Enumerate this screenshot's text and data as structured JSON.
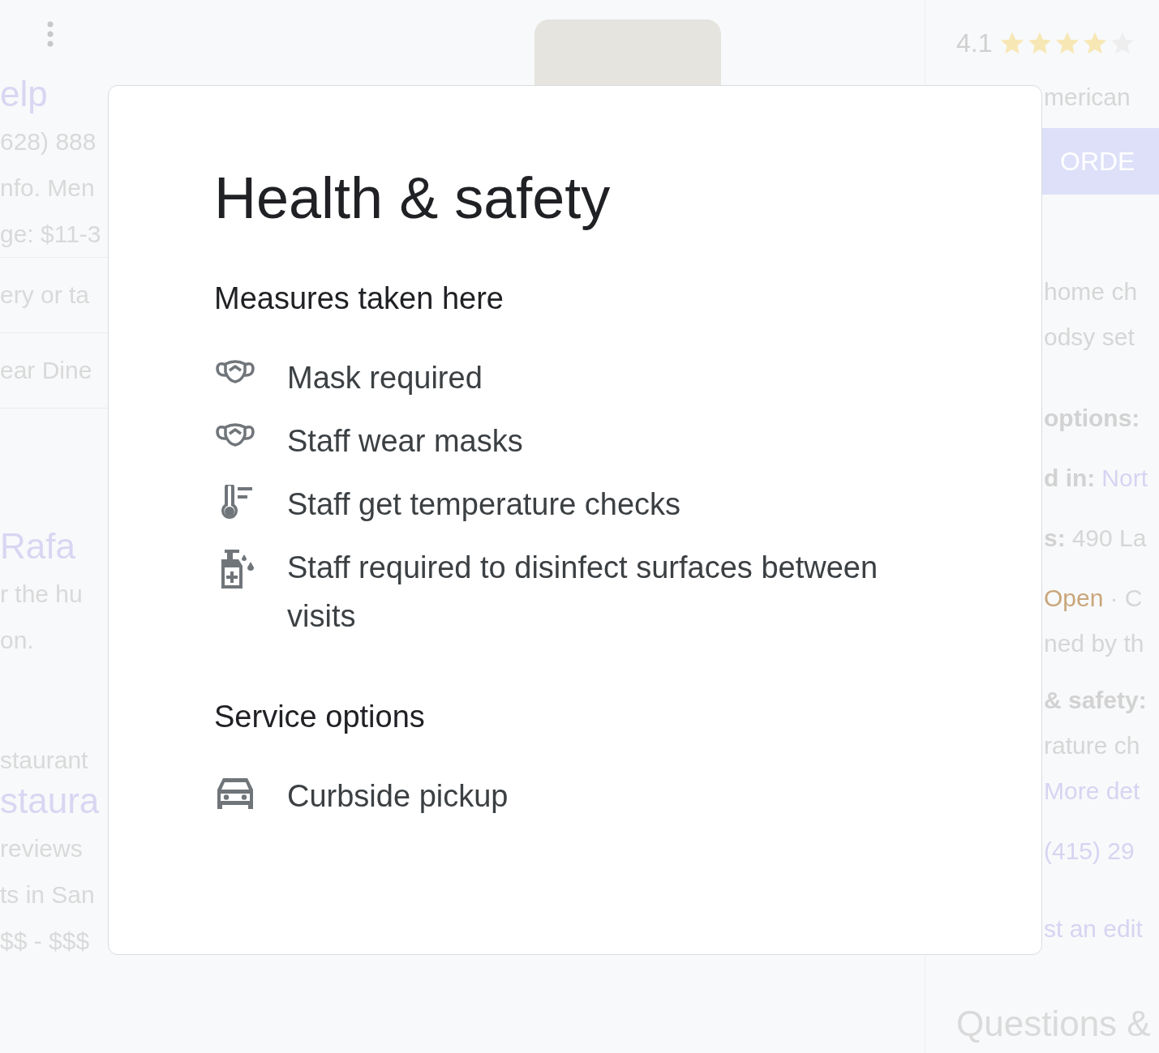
{
  "background": {
    "left_column": [
      {
        "kind": "title",
        "text": "elp"
      },
      {
        "kind": "text",
        "text": "628) 888"
      },
      {
        "kind": "text",
        "text": "nfo. Men"
      },
      {
        "kind": "text",
        "text": "ge: $11-3"
      },
      {
        "kind": "row",
        "text": "ery or ta"
      },
      {
        "kind": "row",
        "text": "ear Dine"
      },
      {
        "kind": "title",
        "text": "Rafa"
      },
      {
        "kind": "text",
        "text": "r the hu"
      },
      {
        "kind": "text",
        "text": "on."
      },
      {
        "kind": "caption",
        "text": "staurant"
      },
      {
        "kind": "title",
        "text": "staura"
      },
      {
        "kind": "text",
        "text": "reviews"
      },
      {
        "kind": "text",
        "text": "ts in San"
      },
      {
        "kind": "text",
        "text": "$$ - $$$"
      }
    ],
    "right_column": {
      "rating": "4.1",
      "stars": 4,
      "lines": [
        {
          "kind": "text",
          "text": "merican"
        },
        {
          "kind": "button",
          "text": "ORDE"
        },
        {
          "kind": "text",
          "text": "home ch"
        },
        {
          "kind": "text",
          "text": "odsy set"
        },
        {
          "kind": "field",
          "label": "options:"
        },
        {
          "kind": "field",
          "label": "d in:",
          "value": "Nort",
          "link": true
        },
        {
          "kind": "field",
          "label": "s:",
          "value": "490 La",
          "link": false
        },
        {
          "kind": "hours",
          "status": "Open",
          "text": "· C"
        },
        {
          "kind": "text",
          "text": "ned by th"
        },
        {
          "kind": "field",
          "label": "& safety:"
        },
        {
          "kind": "text",
          "text": "rature ch"
        },
        {
          "kind": "link",
          "text": "More det"
        },
        {
          "kind": "link",
          "text": "(415) 29"
        },
        {
          "kind": "link",
          "text": "st an edit"
        }
      ],
      "heading": "Questions &"
    }
  },
  "dialog": {
    "title": "Health & safety",
    "sections": [
      {
        "heading": "Measures taken here",
        "items": [
          {
            "kind": "mask",
            "text": "Mask required"
          },
          {
            "kind": "mask",
            "text": "Staff wear masks"
          },
          {
            "kind": "thermometer",
            "text": "Staff get temperature checks"
          },
          {
            "kind": "sanitizer",
            "text": "Staff required to disinfect surfaces between visits"
          }
        ]
      },
      {
        "heading": "Service options",
        "items": [
          {
            "kind": "car",
            "text": "Curbside pickup"
          }
        ]
      }
    ]
  }
}
